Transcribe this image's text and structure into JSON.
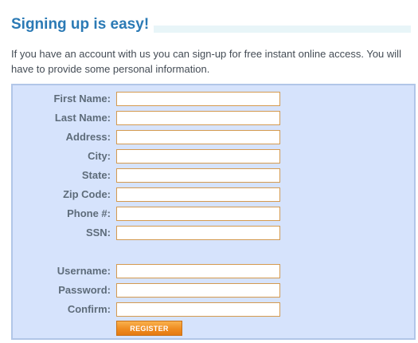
{
  "header": {
    "title": "Signing up is easy!",
    "intro": "If you have an account with us you can sign-up for free instant online access. You will have to provide some personal information."
  },
  "personal_fields": [
    {
      "label": "First Name:",
      "value": ""
    },
    {
      "label": "Last Name:",
      "value": ""
    },
    {
      "label": "Address:",
      "value": ""
    },
    {
      "label": "City:",
      "value": ""
    },
    {
      "label": "State:",
      "value": ""
    },
    {
      "label": "Zip Code:",
      "value": ""
    },
    {
      "label": "Phone #:",
      "value": ""
    },
    {
      "label": "SSN:",
      "value": ""
    }
  ],
  "account_fields": [
    {
      "label": "Username:",
      "value": ""
    },
    {
      "label": "Password:",
      "value": ""
    },
    {
      "label": "Confirm:",
      "value": ""
    }
  ],
  "register_label": "REGISTER",
  "colors": {
    "title": "#2b7ab5",
    "panel_background": "#d6e3fc",
    "input_border": "#d49a50",
    "button": "#ef8c20"
  }
}
